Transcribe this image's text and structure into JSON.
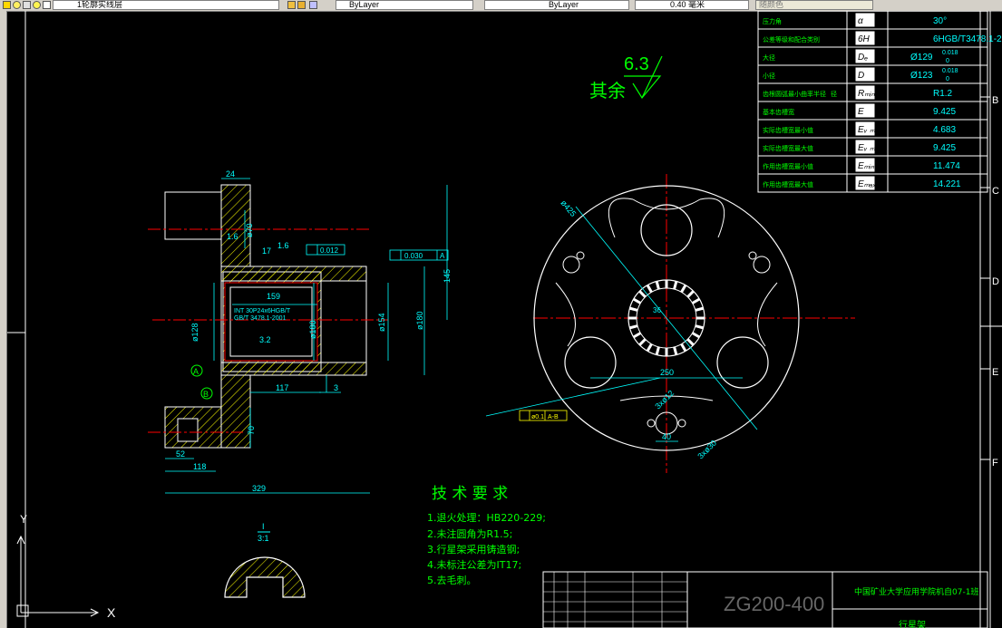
{
  "toolbar": {
    "layer_name": "1轮廓实线层",
    "color_value": "ByLayer",
    "linetype_value": "ByLayer",
    "lineweight_value": "0.40 毫米",
    "plotstyle_value": "随颜色"
  },
  "params_table": {
    "rows": [
      {
        "label": "压力角",
        "symbol": "α",
        "value": "30°"
      },
      {
        "label": "公差等级和配合类别",
        "symbol": "6H",
        "value": "6HGB/T3478.1-2001"
      },
      {
        "label": "大径",
        "symbol": "Dₑ",
        "value": "Ø129",
        "sup": "0.018",
        "sub": "0"
      },
      {
        "label": "小径",
        "symbol": "D",
        "value": "Ø123",
        "sup": "0.018",
        "sub": "0"
      },
      {
        "label": "齿根圆弧最小曲率半径",
        "extra": "径",
        "symbol": "Rₘᵢₙ",
        "value": "R1.2"
      },
      {
        "label": "基本齿槽宽",
        "symbol": "E",
        "value": "9.425"
      },
      {
        "label": "实际齿槽宽最小值",
        "symbol": "Eᵥ ₘᵢₙ",
        "value": "4.683"
      },
      {
        "label": "实际齿槽宽最大值",
        "symbol": "Eᵥ ₘₐₓ",
        "value": "9.425"
      },
      {
        "label": "作用齿槽宽最小值",
        "symbol": "Eₘᵢₙ",
        "value": "11.474"
      },
      {
        "label": "作用齿槽宽最大值",
        "symbol": "Eₘₐₓ",
        "value": "14.221"
      }
    ]
  },
  "border_letters": [
    "B",
    "C",
    "D",
    "E",
    "F"
  ],
  "roughness": {
    "prefix": "其余",
    "value": "6.3"
  },
  "section_view": {
    "dims": [
      "24",
      "ø70",
      "1.6",
      "17",
      "1.6",
      "0.012",
      "0.030",
      "A",
      "145",
      "159",
      "ø128",
      "ø180",
      "ø154",
      "ø180",
      "3.2",
      "117",
      "3",
      "70",
      "52",
      "118",
      "329"
    ],
    "spline_note_1": "INT 30P24x6HGB/T",
    "spline_note_2": "GB/T 3478.1-2001",
    "datum_a": "A",
    "datum_b": "B"
  },
  "front_view": {
    "dims": [
      "ø425",
      "250",
      "3xø12",
      "40",
      "3xø30",
      "ø0.1",
      "A-B",
      "36"
    ]
  },
  "tech_req": {
    "title": "技 术 要 求",
    "items": [
      "1.退火处理：HB220-229;",
      "2.未注圆角为R1.5;",
      "3.行星架采用铸造钢;",
      "4.未标注公差为IT17;",
      "5.去毛刺。"
    ]
  },
  "detail_view": {
    "label_top": "I",
    "label_bottom": "3:1"
  },
  "title_block": {
    "drawing_no": "ZG200-400",
    "school": "中国矿业大学应用学院机自07-1班",
    "part_name": "行星架"
  },
  "ucs": {
    "x_label": "X",
    "y_label": "Y"
  },
  "colors": {
    "green": "#00ff00",
    "white": "#ffffff",
    "cyan": "#00ffff",
    "red": "#ff0000",
    "yellow": "#ffff00",
    "hatch": "#ffff00"
  }
}
